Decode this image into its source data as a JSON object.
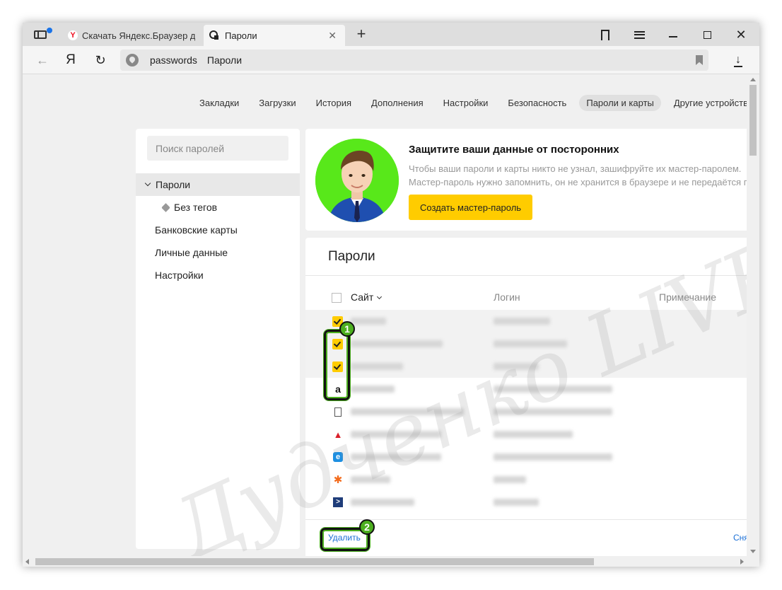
{
  "browser": {
    "tabs": [
      {
        "title": "Скачать Яндекс.Браузер для",
        "favicon": "yandex-icon"
      },
      {
        "title": "Пароли",
        "favicon": "key-icon",
        "close": "✕"
      }
    ],
    "new_tab": "+",
    "address": {
      "url": "passwords",
      "title": "Пароли"
    },
    "nav_ya": "Я",
    "icons": {
      "back": "back-arrow-icon",
      "reload": "reload-icon",
      "download": "download-icon",
      "bookmark": "bookmark-icon"
    }
  },
  "topnav": {
    "items": [
      "Закладки",
      "Загрузки",
      "История",
      "Дополнения",
      "Настройки",
      "Безопасность",
      "Пароли и карты",
      "Другие устройства"
    ],
    "selected": "Пароли и карты"
  },
  "sidebar": {
    "search_placeholder": "Поиск паролей",
    "items": [
      {
        "label": "Пароли"
      },
      {
        "label": "Без тегов"
      },
      {
        "label": "Банковские карты"
      },
      {
        "label": "Личные данные"
      },
      {
        "label": "Настройки"
      }
    ]
  },
  "promo": {
    "title": "Защитите ваши данные от посторонних",
    "text": "Чтобы ваши пароли и карты никто не узнал, зашифруйте их мастер-паролем. Мастер-пароль нужно запомнить, он не хранится в браузере и не передаётся по сети.",
    "button": "Создать мастер-пароль"
  },
  "passwords": {
    "title": "Пароли",
    "columns": {
      "site": "Сайт",
      "login": "Логин",
      "note": "Примечание"
    },
    "selected_count": 3,
    "row_icons": [
      "",
      "",
      "",
      "amazon-icon",
      "file-icon",
      "adobe-icon",
      "ie-icon",
      "avast-icon",
      "powershell-icon"
    ],
    "delete_label": "Удалить",
    "deselect_label": "Снять выделение"
  },
  "annotations": {
    "badge1": "1",
    "badge2": "2",
    "watermark": "Дудченко LIVE"
  },
  "colors": {
    "accent": "#ffcc00",
    "link": "#1a6fd6",
    "highlight": "#4caf1f"
  }
}
